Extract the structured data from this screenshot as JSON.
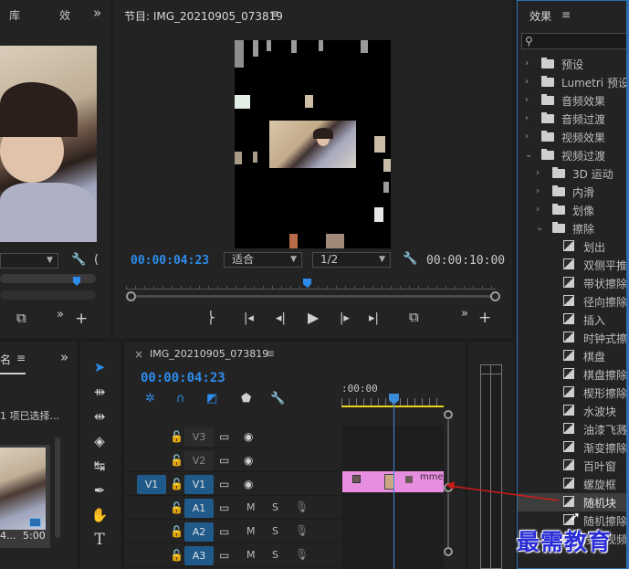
{
  "source_panel": {
    "tab_library": "库",
    "tab_effects_short": "效",
    "overflow": "»",
    "fit_dropdown": "",
    "add_button": "+",
    "export_frame": "⧉"
  },
  "program_monitor": {
    "title": "节目: IMG_20210905_073819",
    "menu_icon": "≡",
    "timecode_current": "00:00:04:23",
    "fit_label": "适合",
    "resolution_label": "1/2",
    "timecode_duration": "00:00:10:00",
    "add_button": "+"
  },
  "project_panel": {
    "tab_name": "名",
    "menu_icon": "≡",
    "overflow": "»",
    "selection_status": "1 项已选择...",
    "clip_name": "4...",
    "clip_duration": "5:00"
  },
  "timeline": {
    "close": "×",
    "sequence_name": "IMG_20210905_073819",
    "menu_icon": "≡",
    "timecode": "00:00:04:23",
    "ruler_start": ":00:00",
    "clip_label": "mme",
    "tracks": [
      {
        "source": "",
        "target": "V3",
        "kind": "video"
      },
      {
        "source": "",
        "target": "V2",
        "kind": "video"
      },
      {
        "source": "V1",
        "target": "V1",
        "kind": "video"
      },
      {
        "source": "",
        "target": "A1",
        "kind": "audio",
        "m": "M",
        "s": "S"
      },
      {
        "source": "",
        "target": "A2",
        "kind": "audio",
        "m": "M",
        "s": "S"
      },
      {
        "source": "",
        "target": "A3",
        "kind": "audio",
        "m": "M",
        "s": "S"
      }
    ]
  },
  "effects_panel": {
    "title": "效果",
    "menu_icon": "≡",
    "search_placeholder": "",
    "items": [
      {
        "label": "预设",
        "depth": 0,
        "type": "folder-star",
        "open": false
      },
      {
        "label": "Lumetri 预设",
        "depth": 0,
        "type": "folder-star",
        "open": false
      },
      {
        "label": "音频效果",
        "depth": 0,
        "type": "folder",
        "open": false
      },
      {
        "label": "音频过渡",
        "depth": 0,
        "type": "folder",
        "open": false
      },
      {
        "label": "视频效果",
        "depth": 0,
        "type": "folder",
        "open": false
      },
      {
        "label": "视频过渡",
        "depth": 0,
        "type": "folder",
        "open": true
      },
      {
        "label": "3D 运动",
        "depth": 1,
        "type": "folder",
        "open": false
      },
      {
        "label": "内滑",
        "depth": 1,
        "type": "folder",
        "open": false
      },
      {
        "label": "划像",
        "depth": 1,
        "type": "folder",
        "open": false
      },
      {
        "label": "擦除",
        "depth": 1,
        "type": "folder",
        "open": true
      },
      {
        "label": "划出",
        "depth": 2,
        "type": "fx"
      },
      {
        "label": "双侧平推",
        "depth": 2,
        "type": "fx"
      },
      {
        "label": "带状擦除",
        "depth": 2,
        "type": "fx"
      },
      {
        "label": "径向擦除",
        "depth": 2,
        "type": "fx"
      },
      {
        "label": "插入",
        "depth": 2,
        "type": "fx"
      },
      {
        "label": "时钟式擦",
        "depth": 2,
        "type": "fx"
      },
      {
        "label": "棋盘",
        "depth": 2,
        "type": "fx"
      },
      {
        "label": "棋盘擦除",
        "depth": 2,
        "type": "fx"
      },
      {
        "label": "楔形擦除",
        "depth": 2,
        "type": "fx"
      },
      {
        "label": "水波块",
        "depth": 2,
        "type": "fx"
      },
      {
        "label": "油漆飞溅",
        "depth": 2,
        "type": "fx"
      },
      {
        "label": "渐变擦除",
        "depth": 2,
        "type": "fx"
      },
      {
        "label": "百叶窗",
        "depth": 2,
        "type": "fx"
      },
      {
        "label": "螺旋框",
        "depth": 2,
        "type": "fx"
      },
      {
        "label": "随机块",
        "depth": 2,
        "type": "fx",
        "selected": true
      },
      {
        "label": "随机擦除",
        "depth": 2,
        "type": "fx"
      },
      {
        "label": "沉浸式视频",
        "depth": 1,
        "type": "folder",
        "open": false
      }
    ]
  },
  "tools": [
    "selection-tool",
    "track-select-tool",
    "ripple-edit-tool",
    "razor-tool",
    "slip-tool",
    "pen-tool",
    "hand-tool",
    "type-tool"
  ],
  "watermark": "最需教育",
  "colors": {
    "accent_blue": "#2d8ceb",
    "clip_pink": "#e78ee0",
    "playhead": "#3b8bdb",
    "watermark": "#2a2cd6",
    "annotation_arrow": "#d11a1a"
  }
}
